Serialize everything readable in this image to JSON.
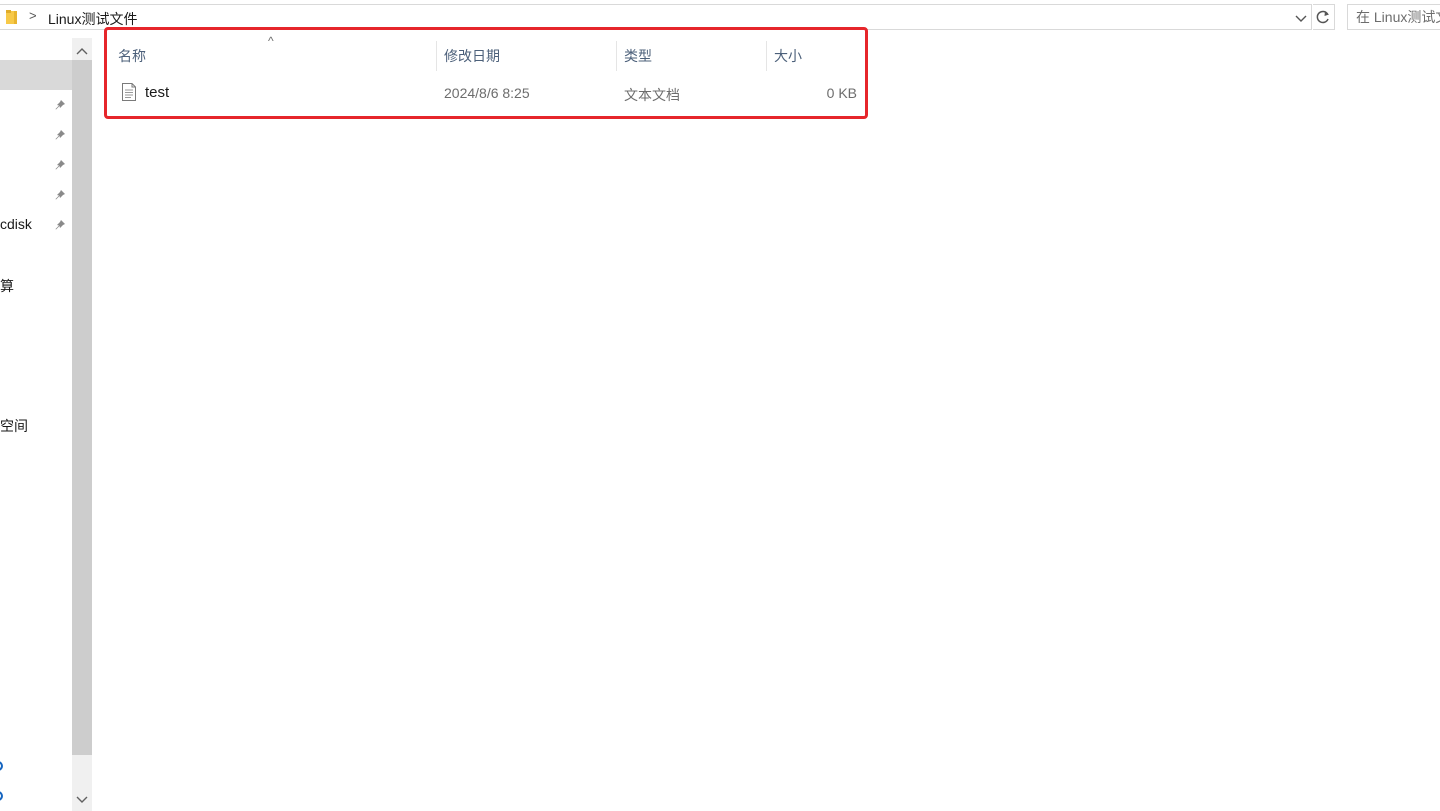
{
  "address_bar": {
    "current_folder": "Linux测试文件",
    "separator": ">"
  },
  "search": {
    "placeholder": "在 Linux测试文件 中搜索"
  },
  "nav_pane": {
    "items": [
      {
        "label": "cdisk",
        "pinned": true
      },
      {
        "label": "云算",
        "pinned": false
      },
      {
        "label": "步空间",
        "pinned": false
      },
      {
        "label": ")",
        "pinned": false
      },
      {
        "label": ")",
        "pinned": false
      }
    ],
    "pinned_only_rows": 4
  },
  "file_list": {
    "columns": {
      "name": "名称",
      "date": "修改日期",
      "type": "类型",
      "size": "大小"
    },
    "sort_indicator": "^",
    "rows": [
      {
        "name": "test",
        "date": "2024/8/6 8:25",
        "type": "文本文档",
        "size": "0 KB"
      }
    ]
  },
  "colors": {
    "highlight_border": "#e6262b",
    "column_header_text": "#4c607a",
    "nav_selection": "#d9d9d9",
    "folder_yellow": "#f7c948"
  }
}
